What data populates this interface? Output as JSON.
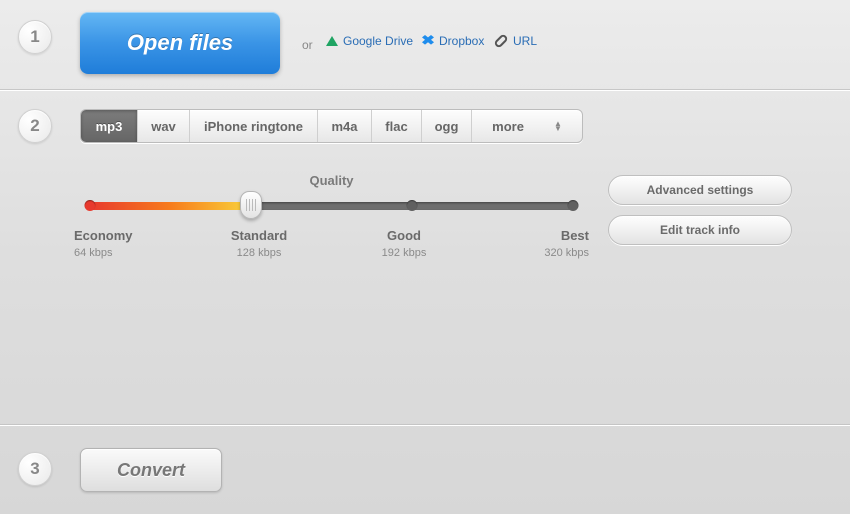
{
  "steps": {
    "one": "1",
    "two": "2",
    "three": "3"
  },
  "open": {
    "button": "Open files",
    "or": "or"
  },
  "sources": {
    "gdrive": "Google Drive",
    "dropbox": "Dropbox",
    "url": "URL"
  },
  "formats": {
    "mp3": "mp3",
    "wav": "wav",
    "iphone": "iPhone ringtone",
    "m4a": "m4a",
    "flac": "flac",
    "ogg": "ogg",
    "more": "more"
  },
  "quality": {
    "title": "Quality",
    "selected_index": 1,
    "levels": [
      {
        "name": "Economy",
        "bitrate": "64 kbps"
      },
      {
        "name": "Standard",
        "bitrate": "128 kbps"
      },
      {
        "name": "Good",
        "bitrate": "192 kbps"
      },
      {
        "name": "Best",
        "bitrate": "320 kbps"
      }
    ]
  },
  "side": {
    "advanced": "Advanced settings",
    "trackinfo": "Edit track info"
  },
  "convert": {
    "button": "Convert"
  }
}
